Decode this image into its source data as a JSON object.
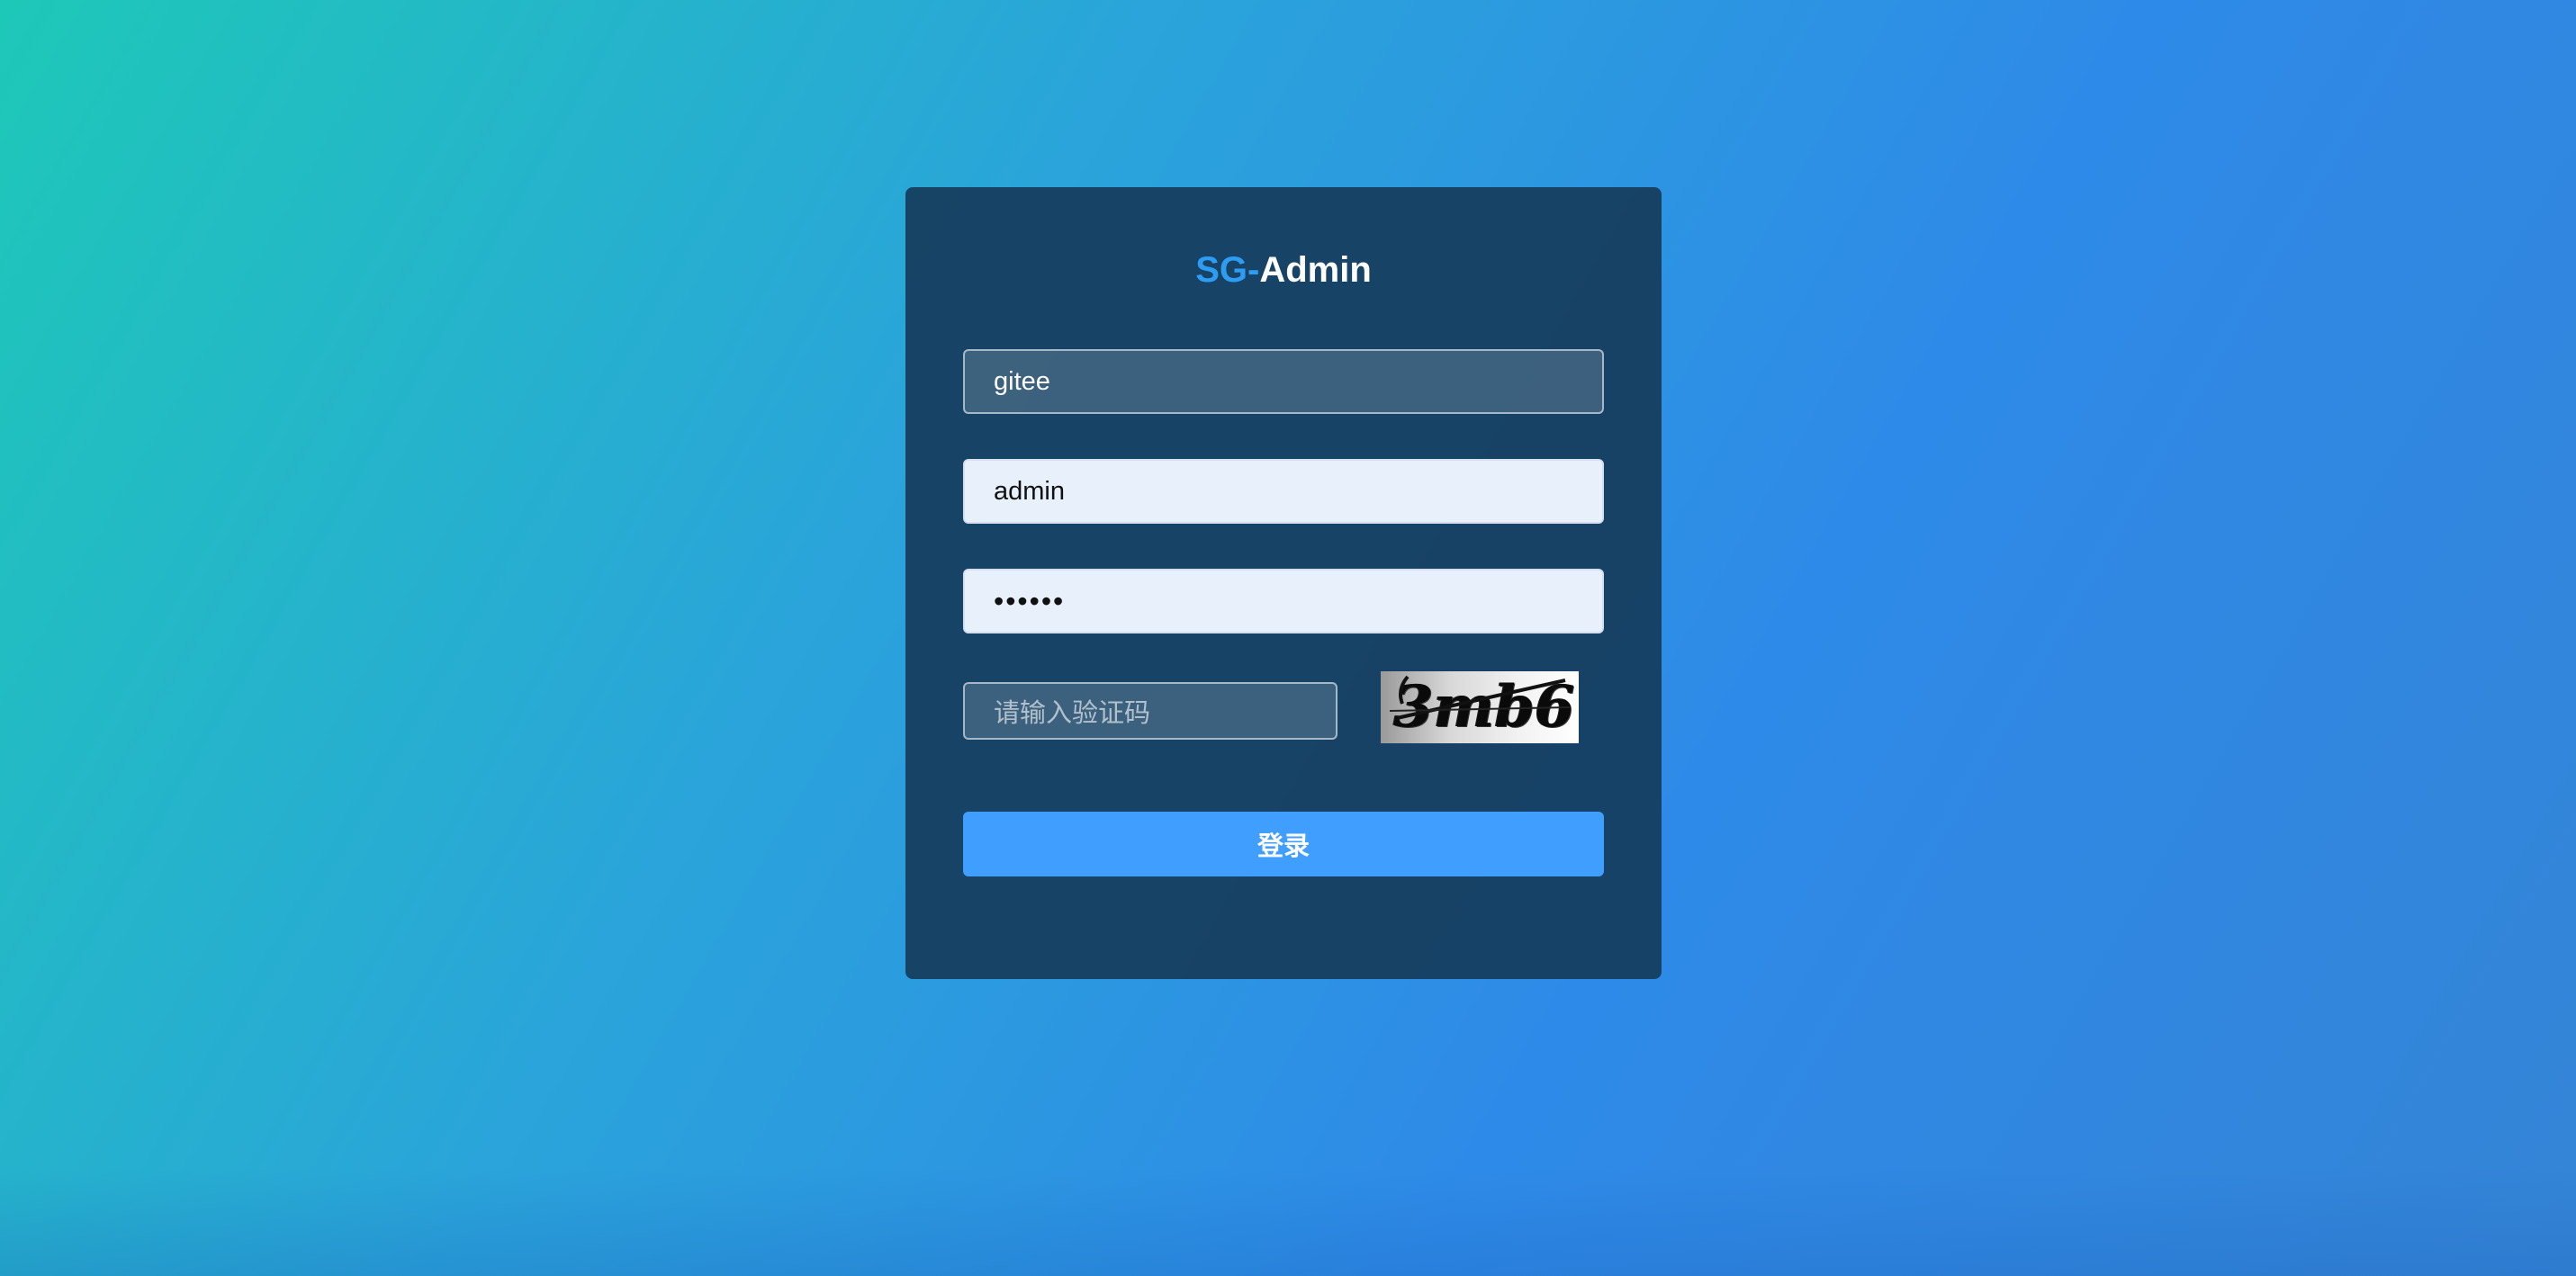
{
  "brand": {
    "prefix": "SG-",
    "suffix": "Admin"
  },
  "form": {
    "tenant_value": "gitee",
    "username_value": "admin",
    "password_display": "••••••",
    "captcha_placeholder": "请输入验证码",
    "captcha_image_text": "3mb6",
    "login_label": "登录"
  },
  "colors": {
    "brand_accent": "#2d9cf2",
    "button": "#409eff",
    "card_background": "#163c5c"
  }
}
